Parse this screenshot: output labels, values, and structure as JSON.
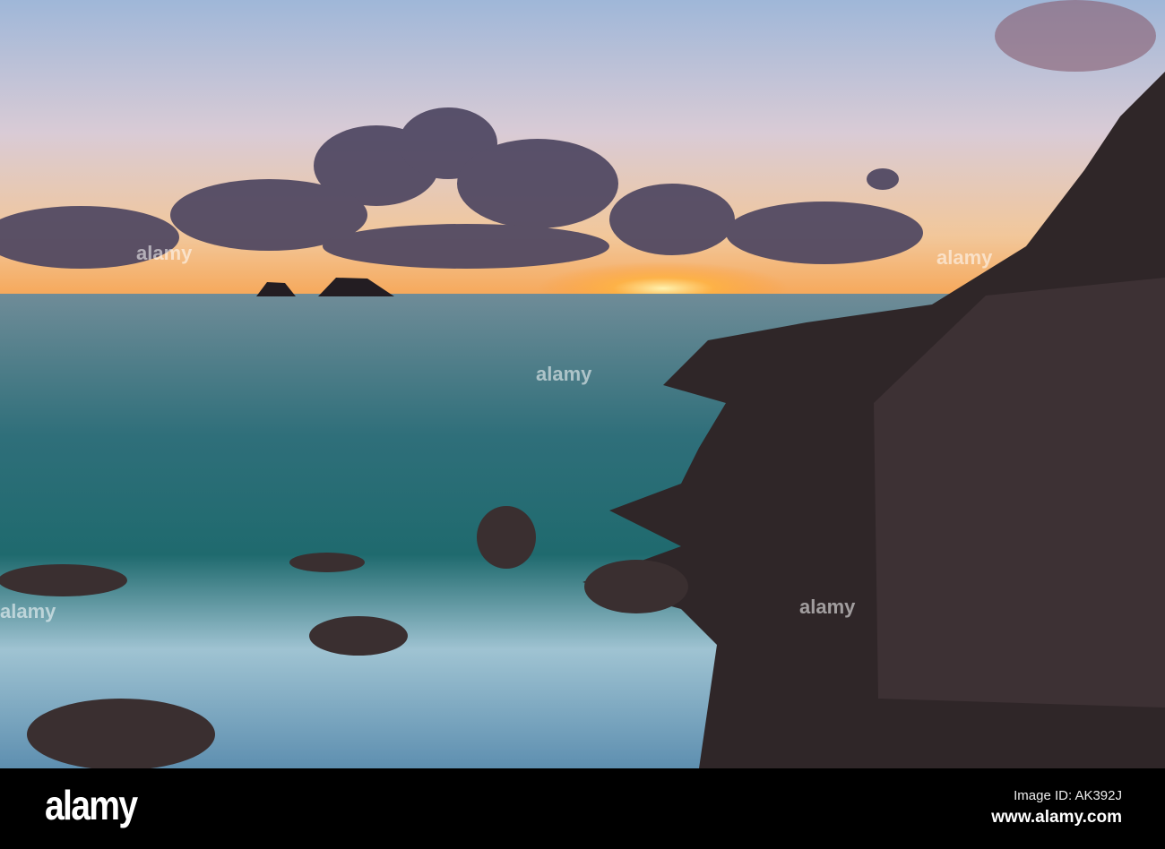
{
  "photo": {
    "subject": "coastal-sunset"
  },
  "watermarks": {
    "center": "alamy",
    "corner": "a"
  },
  "footer": {
    "logo": "alamy",
    "image_id": "Image ID: AK392J",
    "url": "www.alamy.com"
  },
  "colors": {
    "sky_top": "#a7bfdc",
    "horizon": "#f4b26a",
    "sea": "#2f6f7a",
    "rock": "#2f2628"
  }
}
